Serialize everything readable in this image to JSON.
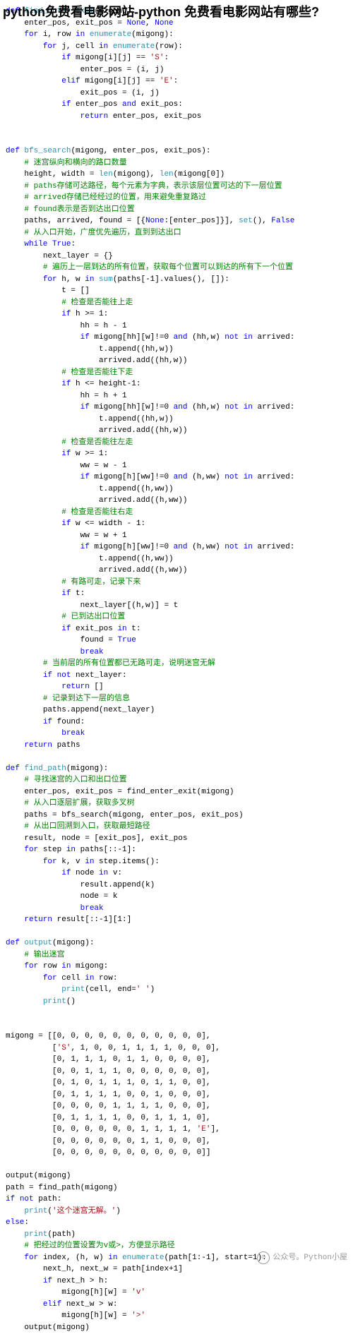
{
  "overlay": "python免费看电影网站-python 免费看电影网站有哪些?",
  "footer_source": "公众号。Python小屋",
  "code": [
    "<span class='kw'>def</span> <span class='fn'>find_enter_exit</span>(migong):",
    "    enter_pos, exit_pos = <span class='bn'>None</span>, <span class='bn'>None</span>",
    "    <span class='kw'>for</span> i, row <span class='kw'>in</span> <span class='fn'>enumerate</span>(migong):",
    "        <span class='kw'>for</span> j, cell <span class='kw'>in</span> <span class='fn'>enumerate</span>(row):",
    "            <span class='kw'>if</span> migong[i][j] == <span class='st'>'S'</span>:",
    "                enter_pos = (i, j)",
    "            <span class='kw'>elif</span> migong[i][j] == <span class='st'>'E'</span>:",
    "                exit_pos = (i, j)",
    "            <span class='kw'>if</span> enter_pos <span class='kw'>and</span> exit_pos:",
    "                <span class='kw'>return</span> enter_pos, exit_pos",
    "",
    "",
    "<span class='kw'>def</span> <span class='fn'>bfs_search</span>(migong, enter_pos, exit_pos):",
    "    <span class='cm'># 迷宫纵向和横向的路口数量</span>",
    "    height, width = <span class='fn'>len</span>(migong), <span class='fn'>len</span>(migong[0])",
    "    <span class='cm'># paths存储可达路径，每个元素为字典，表示该层位置可达的下一层位置</span>",
    "    <span class='cm'># arrived存储已经经过的位置，用来避免重复路过</span>",
    "    <span class='cm'># found表示是否到达出口位置</span>",
    "    paths, arrived, found = [{<span class='bn'>None</span>:[enter_pos]}], <span class='fn'>set</span>(), <span class='bn'>False</span>",
    "    <span class='cm'># 从入口开始，广度优先遍历，直到到达出口</span>",
    "    <span class='kw'>while</span> <span class='bn'>True</span>:",
    "        next_layer = {}",
    "        <span class='cm'># 遍历上一层到达的所有位置，获取每个位置可以到达的所有下一个位置</span>",
    "        <span class='kw'>for</span> h, w <span class='kw'>in</span> <span class='fn'>sum</span>(paths[-1].values(), []):",
    "            t = []",
    "            <span class='cm'># 检查是否能往上走</span>",
    "            <span class='kw'>if</span> h >= 1:",
    "                hh = h - 1",
    "                <span class='kw'>if</span> migong[hh][w]!=0 <span class='kw'>and</span> (hh,w) <span class='kw'>not</span> <span class='kw'>in</span> arrived:",
    "                    t.append((hh,w))",
    "                    arrived.add((hh,w))",
    "            <span class='cm'># 检查是否能往下走</span>",
    "            <span class='kw'>if</span> h <= height-1:",
    "                hh = h + 1",
    "                <span class='kw'>if</span> migong[hh][w]!=0 <span class='kw'>and</span> (hh,w) <span class='kw'>not</span> <span class='kw'>in</span> arrived:",
    "                    t.append((hh,w))",
    "                    arrived.add((hh,w))",
    "            <span class='cm'># 检查是否能往左走</span>",
    "            <span class='kw'>if</span> w >= 1:",
    "                ww = w - 1",
    "                <span class='kw'>if</span> migong[h][ww]!=0 <span class='kw'>and</span> (h,ww) <span class='kw'>not</span> <span class='kw'>in</span> arrived:",
    "                    t.append((h,ww))",
    "                    arrived.add((h,ww))",
    "            <span class='cm'># 检查是否能往右走</span>",
    "            <span class='kw'>if</span> w <= width - 1:",
    "                ww = w + 1",
    "                <span class='kw'>if</span> migong[h][ww]!=0 <span class='kw'>and</span> (h,ww) <span class='kw'>not</span> <span class='kw'>in</span> arrived:",
    "                    t.append((h,ww))",
    "                    arrived.add((h,ww))",
    "            <span class='cm'># 有路可走，记录下来</span>",
    "            <span class='kw'>if</span> t:",
    "                next_layer[(h,w)] = t",
    "            <span class='cm'># 已到达出口位置</span>",
    "            <span class='kw'>if</span> exit_pos <span class='kw'>in</span> t:",
    "                found = <span class='bn'>True</span>",
    "                <span class='kw'>break</span>",
    "        <span class='cm'># 当前层的所有位置都已无路可走，说明迷宫无解</span>",
    "        <span class='kw'>if</span> <span class='kw'>not</span> next_layer:",
    "            <span class='kw'>return</span> []",
    "        <span class='cm'># 记录到达下一层的信息</span>",
    "        paths.append(next_layer)",
    "        <span class='kw'>if</span> found:",
    "            <span class='kw'>break</span>",
    "    <span class='kw'>return</span> paths",
    "",
    "<span class='kw'>def</span> <span class='fn'>find_path</span>(migong):",
    "    <span class='cm'># 寻找迷宫的入口和出口位置</span>",
    "    enter_pos, exit_pos = find_enter_exit(migong)",
    "    <span class='cm'># 从入口逐层扩展，获取多叉树</span>",
    "    paths = bfs_search(migong, enter_pos, exit_pos)",
    "    <span class='cm'># 从出口回溯到入口，获取最短路径</span>",
    "    result, node = [exit_pos], exit_pos",
    "    <span class='kw'>for</span> step <span class='kw'>in</span> paths[::-1]:",
    "        <span class='kw'>for</span> k, v <span class='kw'>in</span> step.items():",
    "            <span class='kw'>if</span> node <span class='kw'>in</span> v:",
    "                result.append(k)",
    "                node = k",
    "                <span class='kw'>break</span>",
    "    <span class='kw'>return</span> result[::-1][1:]",
    "",
    "<span class='kw'>def</span> <span class='fn'>output</span>(migong):",
    "    <span class='cm'># 输出迷宫</span>",
    "    <span class='kw'>for</span> row <span class='kw'>in</span> migong:",
    "        <span class='kw'>for</span> cell <span class='kw'>in</span> row:",
    "            <span class='fn'>print</span>(cell, end=<span class='st'>' '</span>)",
    "        <span class='fn'>print</span>()",
    "",
    "",
    "migong = [[0, 0, 0, 0, 0, 0, 0, 0, 0, 0, 0],",
    "          [<span class='st'>'S'</span>, 1, 0, 0, 1, 1, 1, 1, 0, 0, 0],",
    "          [0, 1, 1, 1, 0, 1, 1, 0, 0, 0, 0],",
    "          [0, 0, 1, 1, 1, 0, 0, 0, 0, 0, 0],",
    "          [0, 1, 0, 1, 1, 1, 0, 1, 1, 0, 0],",
    "          [0, 1, 1, 1, 1, 0, 0, 1, 0, 0, 0],",
    "          [0, 0, 0, 0, 1, 1, 1, 1, 0, 0, 0],",
    "          [0, 1, 1, 1, 1, 0, 0, 1, 1, 1, 0],",
    "          [0, 0, 0, 0, 0, 0, 1, 1, 1, 1, <span class='st'>'E'</span>],",
    "          [0, 0, 0, 0, 0, 0, 1, 1, 0, 0, 0],",
    "          [0, 0, 0, 0, 0, 0, 0, 0, 0, 0, 0]]",
    "",
    "output(migong)",
    "path = find_path(migong)",
    "<span class='kw'>if</span> <span class='kw'>not</span> path:",
    "    <span class='fn'>print</span>(<span class='st'>'这个迷宫无解。'</span>)",
    "<span class='kw'>else</span>:",
    "    <span class='fn'>print</span>(path)",
    "    <span class='cm'># 把经过的位置设置为v或&gt;，方便显示路径</span>",
    "    <span class='kw'>for</span> index, (h, w) <span class='kw'>in</span> <span class='fn'>enumerate</span>(path[1:-1], start=1):",
    "        next_h, next_w = path[index+1]",
    "        <span class='kw'>if</span> next_h > h:",
    "            migong[h][w] = <span class='st'>'v'</span>",
    "        <span class='kw'>elif</span> next_w > w:",
    "            migong[h][w] = <span class='st'>'>'</span>",
    "    output(migong)"
  ]
}
